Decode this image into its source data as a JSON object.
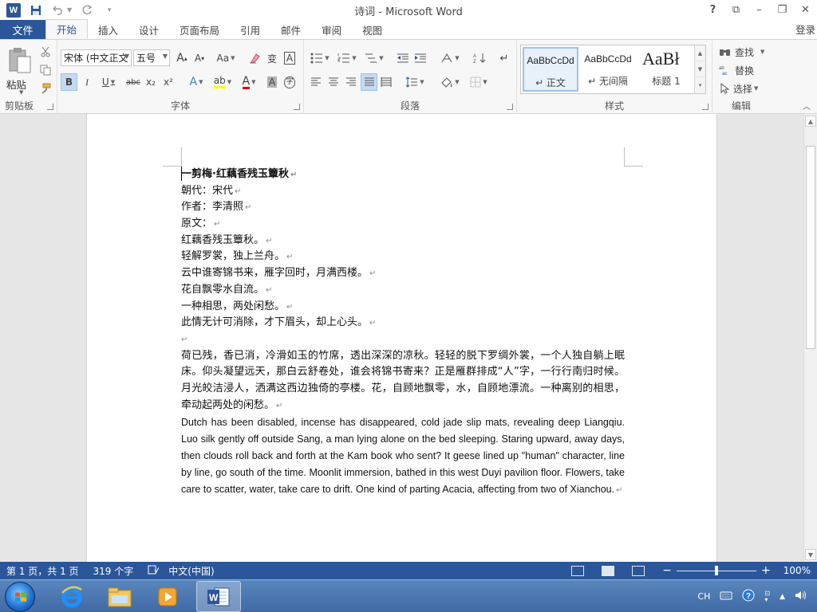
{
  "titlebar": {
    "title": "诗词 - Microsoft Word",
    "app_icon": "W",
    "qat": [
      "save-icon",
      "undo-icon",
      "redo-icon"
    ],
    "controls": [
      "?",
      "⧉",
      "–",
      "❐",
      "✕"
    ]
  },
  "tabs": {
    "file": "文件",
    "items": [
      "开始",
      "插入",
      "设计",
      "页面布局",
      "引用",
      "邮件",
      "审阅",
      "视图"
    ],
    "active": "开始",
    "login": "登录"
  },
  "ribbon": {
    "clipboard": {
      "label": "剪贴板",
      "paste": "粘贴"
    },
    "font": {
      "label": "字体",
      "font_name": "宋体 (中文正文",
      "font_size": "五号",
      "bold": "B",
      "italic": "I",
      "underline": "U",
      "strike": "abc",
      "sub": "x₂",
      "sup": "x²",
      "grow": "A",
      "shrink": "A",
      "case": "Aa",
      "effects": "A",
      "highlight": "ab",
      "color": "A",
      "shade": "A",
      "phonetic": "变",
      "border_char": "A",
      "enclose": "字"
    },
    "paragraph": {
      "label": "段落"
    },
    "styles": {
      "label": "样式",
      "items": [
        {
          "sample": "AaBbCcDd",
          "name": "↵ 正文"
        },
        {
          "sample": "AaBbCcDd",
          "name": "↵ 无间隔"
        },
        {
          "sample": "AaBł",
          "name": "标题 1"
        }
      ]
    },
    "editing": {
      "label": "编辑",
      "find": "查找",
      "replace": "替换",
      "select": "选择"
    }
  },
  "document": {
    "lines": [
      "一剪梅·红藕香残玉簟秋",
      "朝代：宋代",
      "作者：李清照",
      "原文：",
      "红藕香残玉簟秋。",
      "轻解罗裳，独上兰舟。",
      "云中谁寄锦书来，雁字回时，月满西楼。",
      "花自飘零水自流。",
      "一种相思，两处闲愁。",
      "此情无计可消除，才下眉头，却上心头。",
      ""
    ],
    "para_zh": "荷已残，香已消，冷滑如玉的竹席，透出深深的凉秋。轻轻的脱下罗绸外裳，一个人独自躺上眠床。仰头凝望远天，那白云舒卷处，谁会将锦书寄来？正是雁群排成“人”字，一行行南归时候。月光皎洁浸人，洒满这西边独倚的亭楼。花，自顾地飘零，水，自顾地漂流。一种离别的相思，牵动起两处的闲愁。",
    "para_en": "Dutch has been disabled, incense has disappeared, cold jade slip mats, revealing deep Liangqiu. Luo silk gently off outside Sang, a man lying alone on the bed sleeping. Staring upward, away days, then clouds roll back and forth at the Kam book who sent? It geese lined up \"human\" character, line by line, go south of the time. Moonlit immersion, bathed in this west Duyi pavilion floor. Flowers, take care to scatter, water, take care to drift. One kind of parting Acacia, affecting from two of Xianchou.",
    "pilcrow": "↵"
  },
  "statusbar": {
    "page": "第 1 页，共 1 页",
    "words": "319 个字",
    "language": "中文(中国)",
    "zoom": "100%",
    "zoom_minus": "−",
    "zoom_plus": "+"
  },
  "taskbar": {
    "apps": [
      "internet-explorer-icon",
      "file-explorer-icon",
      "media-player-icon",
      "word-icon"
    ],
    "tray_lang": "CH"
  },
  "colors": {
    "accent": "#2b579a",
    "ribbon_bg": "#f7f7f7",
    "selection": "#c5daf2"
  }
}
